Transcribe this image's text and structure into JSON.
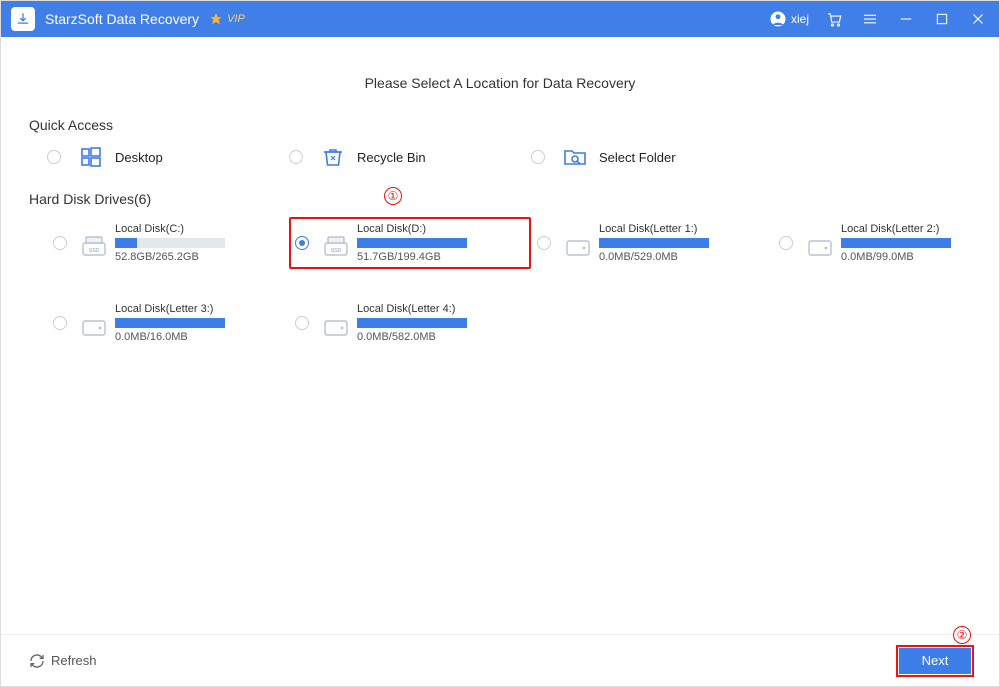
{
  "titlebar": {
    "app_name": "StarzSoft Data Recovery",
    "vip_label": "VIP",
    "username": "xiej"
  },
  "page": {
    "title": "Please Select A Location for Data Recovery",
    "quick_access_label": "Quick Access",
    "hard_disk_label": "Hard Disk Drives(6)"
  },
  "quick": [
    {
      "label": "Desktop",
      "icon": "windows"
    },
    {
      "label": "Recycle Bin",
      "icon": "recycle"
    },
    {
      "label": "Select Folder",
      "icon": "folder-search"
    }
  ],
  "drives": [
    {
      "name": "Local Disk(C:)",
      "usage": "52.8GB/265.2GB",
      "fill": 20,
      "type": "ssd",
      "selected": false
    },
    {
      "name": "Local Disk(D:)",
      "usage": "51.7GB/199.4GB",
      "fill": 100,
      "type": "ssd",
      "selected": true
    },
    {
      "name": "Local Disk(Letter 1:)",
      "usage": "0.0MB/529.0MB",
      "fill": 100,
      "type": "hdd",
      "selected": false
    },
    {
      "name": "Local Disk(Letter 2:)",
      "usage": "0.0MB/99.0MB",
      "fill": 100,
      "type": "hdd",
      "selected": false
    },
    {
      "name": "Local Disk(Letter 3:)",
      "usage": "0.0MB/16.0MB",
      "fill": 100,
      "type": "hdd",
      "selected": false
    },
    {
      "name": "Local Disk(Letter 4:)",
      "usage": "0.0MB/582.0MB",
      "fill": 100,
      "type": "hdd",
      "selected": false
    }
  ],
  "footer": {
    "refresh_label": "Refresh",
    "next_label": "Next"
  },
  "annotations": {
    "drive_marker": "①",
    "next_marker": "②"
  }
}
